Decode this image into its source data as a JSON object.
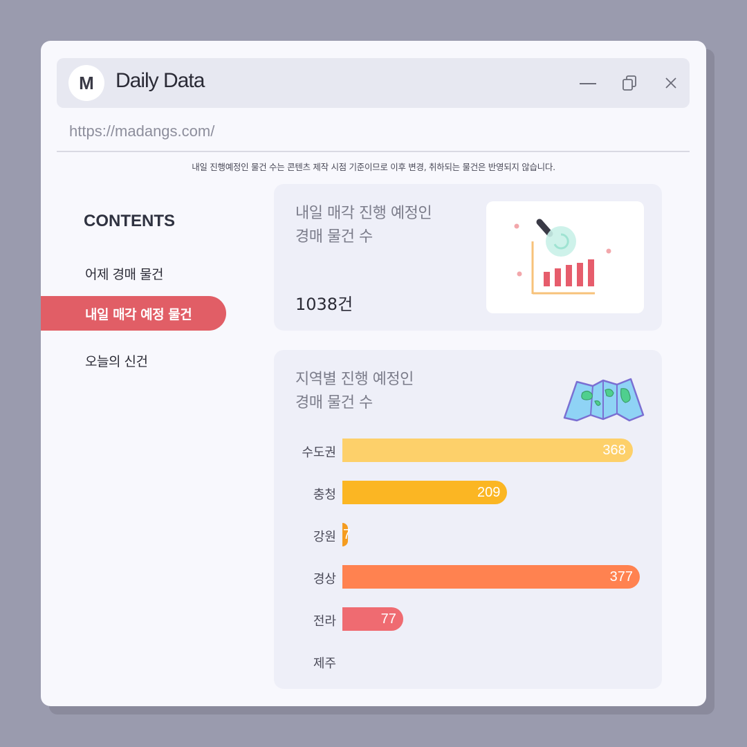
{
  "window": {
    "avatar_letter": "M",
    "title": "Daily Data",
    "url": "https://madangs.com/",
    "notice": "내일 진행예정인 물건 수는 콘텐츠 제작 시점 기준이므로 이후 변경, 취하되는 물건은 반영되지 않습니다."
  },
  "sidebar": {
    "heading": "CONTENTS",
    "items": [
      {
        "label": "어제 경매 물건"
      },
      {
        "label": "내일 매각 예정 물건"
      },
      {
        "label": "오늘의 신건"
      }
    ]
  },
  "card_total": {
    "title": "내일 매각 진행 예정인\n경매 물건 수",
    "count": "1038건"
  },
  "card_region": {
    "title": "지역별 진행 예정인\n경매 물건 수"
  },
  "chart_data": {
    "type": "bar",
    "orientation": "horizontal",
    "categories": [
      "수도권",
      "충청",
      "강원",
      "경상",
      "전라",
      "제주"
    ],
    "values": [
      368,
      209,
      7,
      377,
      77,
      0
    ],
    "colors": [
      "#fdd06a",
      "#fbb623",
      "#f59c1f",
      "#ff8250",
      "#ef6b71",
      "#eeeff8"
    ],
    "xlim": [
      0,
      377
    ]
  }
}
